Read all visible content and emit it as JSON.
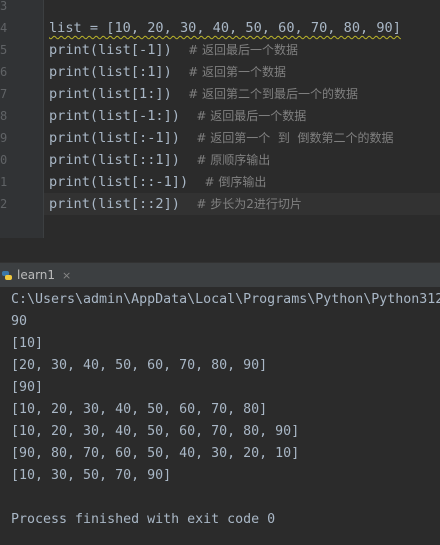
{
  "editor": {
    "line_numbers": [
      "3",
      "4",
      "5",
      "6",
      "7",
      "8",
      "9",
      "0",
      "1",
      "2"
    ],
    "lines": [
      {
        "code": "",
        "comment": ""
      },
      {
        "code": "list = [10, 20, 30, 40, 50, 60, 70, 80, 90]",
        "comment": ""
      },
      {
        "code": "print(list[-1])",
        "comment": "# 返回最后一个数据"
      },
      {
        "code": "print(list[:1])",
        "comment": "# 返回第一个数据"
      },
      {
        "code": "print(list[1:])",
        "comment": "# 返回第二个到最后一个的数据"
      },
      {
        "code": "print(list[-1:])",
        "comment": "# 返回最后一个数据"
      },
      {
        "code": "print(list[:-1])",
        "comment": "# 返回第一个  到  倒数第二个的数据"
      },
      {
        "code": "print(list[::1])",
        "comment": "# 原顺序输出"
      },
      {
        "code": "print(list[::-1])",
        "comment": "# 倒序输出"
      },
      {
        "code": "print(list[::2])",
        "comment": "# 步长为2进行切片"
      }
    ]
  },
  "run_panel": {
    "tab_label": "learn1",
    "close_glyph": "×"
  },
  "console": {
    "lines": [
      "C:\\Users\\admin\\AppData\\Local\\Programs\\Python\\Python312",
      "90",
      "[10]",
      "[20, 30, 40, 50, 60, 70, 80, 90]",
      "[90]",
      "[10, 20, 30, 40, 50, 60, 70, 80]",
      "[10, 20, 30, 40, 50, 60, 70, 80, 90]",
      "[90, 80, 70, 60, 50, 40, 30, 20, 10]",
      "[10, 30, 50, 70, 90]",
      "",
      "Process finished with exit code 0"
    ]
  }
}
